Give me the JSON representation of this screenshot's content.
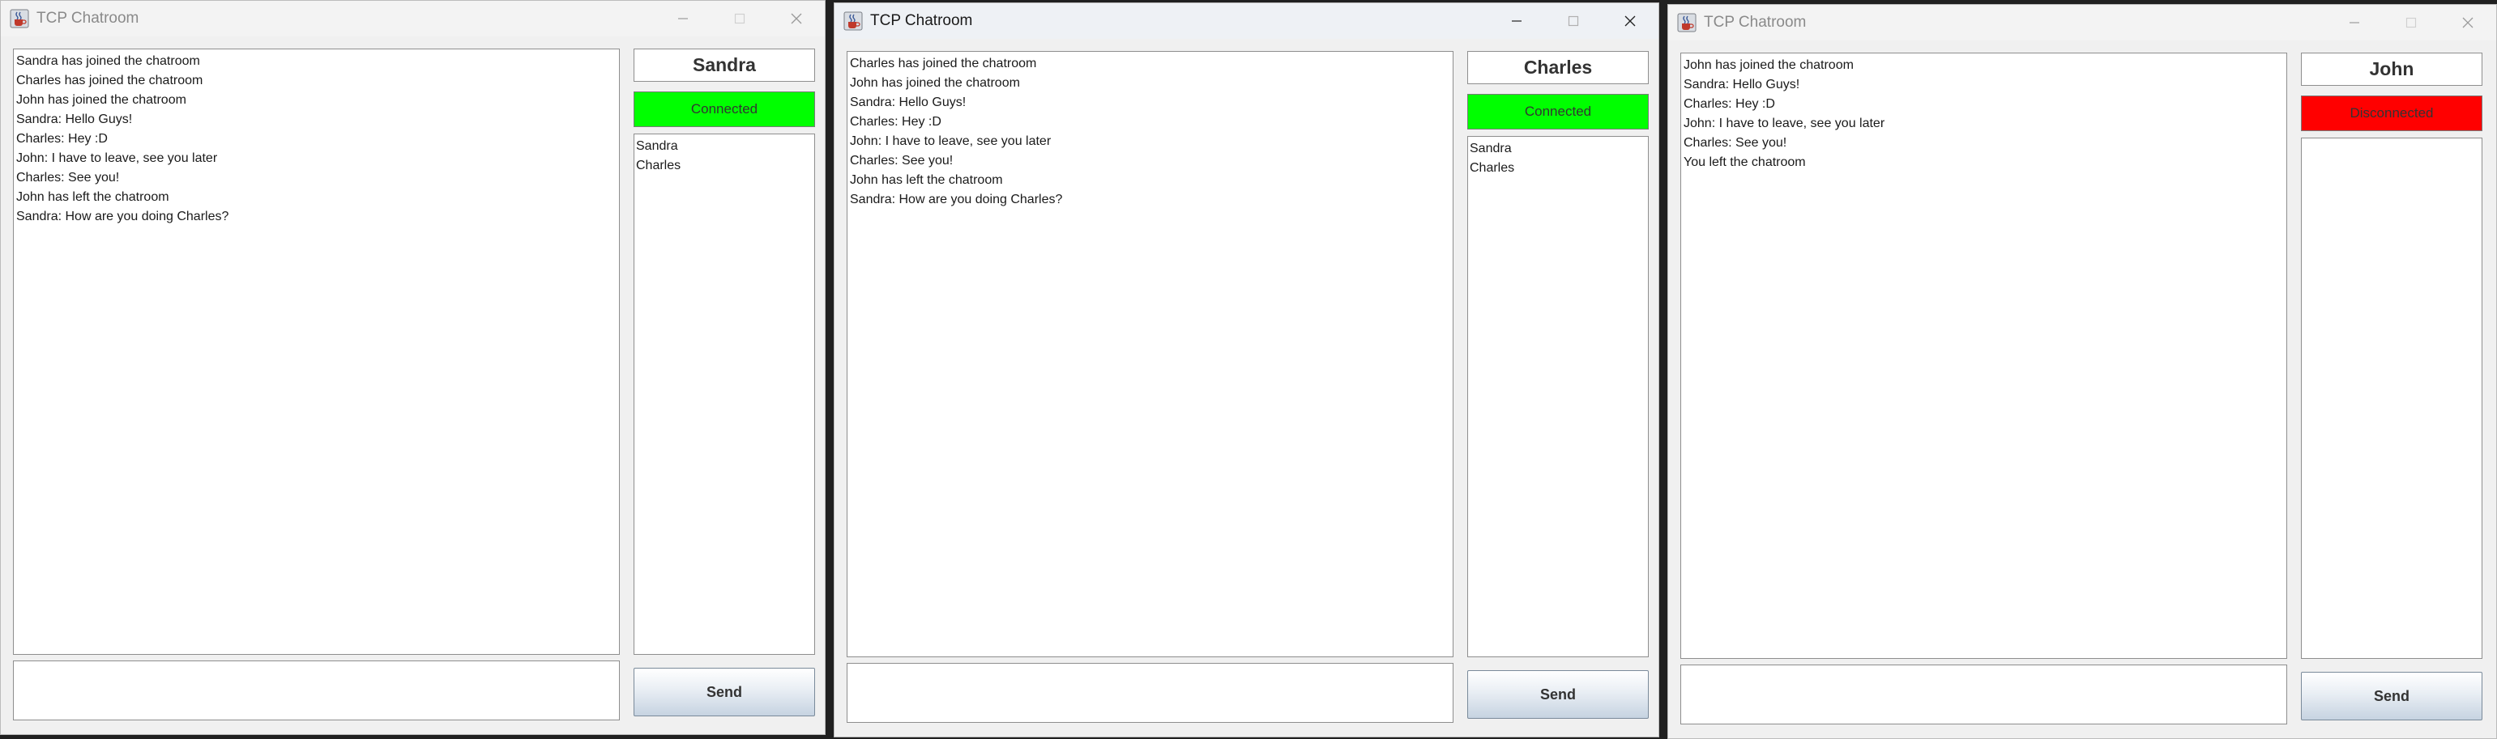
{
  "colors": {
    "connected": "#00ff00",
    "disconnected": "#ff0000"
  },
  "windows": [
    {
      "title": "TCP Chatroom",
      "username": "Sandra",
      "status": "Connected",
      "status_color": "#00ff00",
      "messages": [
        "Sandra has joined the chatroom",
        "Charles has joined the chatroom",
        "John has joined the chatroom",
        "Sandra: Hello Guys!",
        "Charles: Hey :D",
        "John: I have to leave, see you later",
        "Charles: See you!",
        "John has left the chatroom",
        "Sandra: How are you doing Charles?"
      ],
      "users": [
        "Sandra",
        "Charles"
      ],
      "input_value": "",
      "send_label": "Send"
    },
    {
      "title": "TCP Chatroom",
      "username": "Charles",
      "status": "Connected",
      "status_color": "#00ff00",
      "messages": [
        "Charles has joined the chatroom",
        "John has joined the chatroom",
        "Sandra: Hello Guys!",
        "Charles: Hey :D",
        "John: I have to leave, see you later",
        "Charles: See you!",
        "John has left the chatroom",
        "Sandra: How are you doing Charles?"
      ],
      "users": [
        "Sandra",
        "Charles"
      ],
      "input_value": "",
      "send_label": "Send"
    },
    {
      "title": "TCP Chatroom",
      "username": "John",
      "status": "Disconnected",
      "status_color": "#ff0000",
      "messages": [
        "John has joined the chatroom",
        "Sandra: Hello Guys!",
        "Charles: Hey :D",
        "John: I have to leave, see you later",
        "Charles: See you!",
        "You left the chatroom"
      ],
      "users": [],
      "input_value": "",
      "send_label": "Send"
    }
  ]
}
